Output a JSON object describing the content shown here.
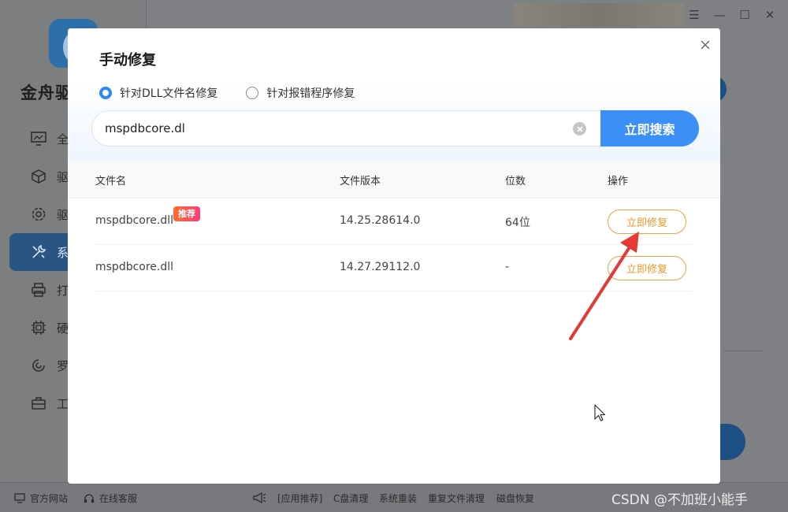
{
  "app": {
    "name": "金舟驱",
    "nav": [
      {
        "label": "全",
        "icon": "monitor-icon"
      },
      {
        "label": "驱",
        "icon": "cube-icon"
      },
      {
        "label": "驱",
        "icon": "gear-icon"
      },
      {
        "label": "系",
        "icon": "wrench-icon"
      },
      {
        "label": "打",
        "icon": "printer-icon"
      },
      {
        "label": "硬",
        "icon": "chip-icon"
      },
      {
        "label": "罗",
        "icon": "speaker-icon"
      },
      {
        "label": "工",
        "icon": "toolbox-icon"
      }
    ],
    "active_nav_index": 3,
    "window_controls": [
      "menu",
      "minimize",
      "maximize",
      "close"
    ]
  },
  "footer": {
    "left": [
      {
        "label": "官方网站",
        "icon": "monitor-icon"
      },
      {
        "label": "在线客服",
        "icon": "headset-icon"
      }
    ],
    "links": [
      "[应用推荐]",
      "C盘清理",
      "系统重装",
      "重复文件清理",
      "磁盘恢复"
    ],
    "watermark": "CSDN @不加班小能手"
  },
  "dialog": {
    "title": "手动修复",
    "radios": [
      {
        "label": "针对DLL文件名修复",
        "checked": true
      },
      {
        "label": "针对报错程序修复",
        "checked": false
      }
    ],
    "search": {
      "value": "mspdbcore.dl",
      "button": "立即搜索"
    },
    "table": {
      "headers": [
        "文件名",
        "文件版本",
        "位数",
        "操作"
      ],
      "rows": [
        {
          "name": "mspdbcore.dll",
          "badge": "推荐",
          "version": "14.25.28614.0",
          "bits": "64位",
          "action": "立即修复"
        },
        {
          "name": "mspdbcore.dll",
          "badge": "",
          "version": "14.27.29112.0",
          "bits": "-",
          "action": "立即修复"
        }
      ]
    }
  },
  "colors": {
    "accent": "#3b8ff6",
    "action": "#f0962a",
    "annotation_arrow": "#e53935",
    "badge": "#ff4f5a"
  }
}
